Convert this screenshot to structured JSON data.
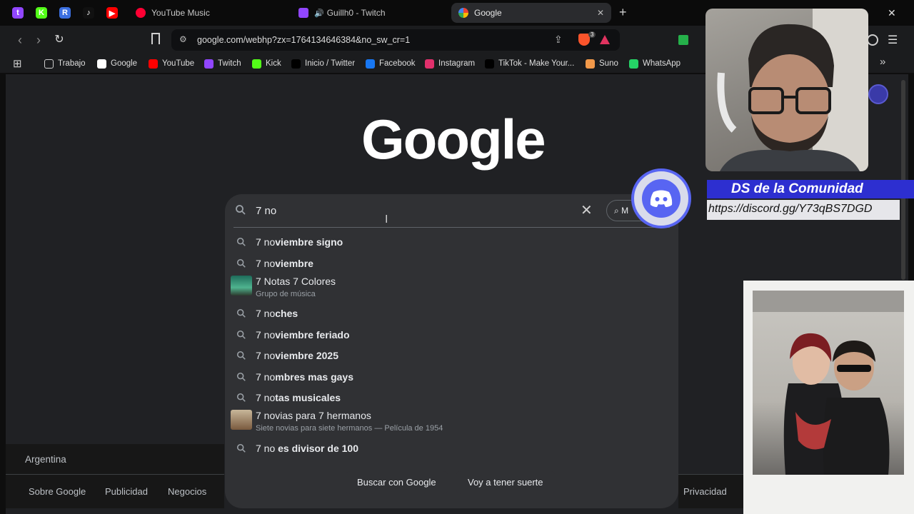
{
  "tabs": {
    "pinned": [
      {
        "name": "twitch-pinned-tab",
        "color": "#9146ff",
        "glyph": "t"
      },
      {
        "name": "kick-pinned-tab",
        "color": "#53fc18",
        "glyph": "K"
      },
      {
        "name": "pinned-tab-r",
        "color": "#3b6fe0",
        "glyph": "R"
      },
      {
        "name": "tiktok-pinned-tab",
        "color": "#111111",
        "glyph": "♪"
      },
      {
        "name": "youtube-pinned-tab",
        "color": "#ff0000",
        "glyph": "▶"
      }
    ],
    "items": [
      {
        "label": "YouTube Music",
        "color": "#ff0033"
      },
      {
        "label": "Guillh0 - Twitch",
        "color": "#9146ff"
      },
      {
        "label": "Google",
        "color": "#ffffff"
      }
    ],
    "new_tab": "+",
    "close_window": "✕"
  },
  "toolbar": {
    "url": "google.com/webhp?zx=1764134646384&no_sw_cr=1",
    "brave_badge": "3"
  },
  "bookmarks": [
    {
      "label": "Trabajo",
      "color": "#3c4043"
    },
    {
      "label": "Google",
      "color": "#ffffff"
    },
    {
      "label": "YouTube",
      "color": "#ff0000"
    },
    {
      "label": "Twitch",
      "color": "#9146ff"
    },
    {
      "label": "Kick",
      "color": "#53fc18"
    },
    {
      "label": "Inicio / Twitter",
      "color": "#000000"
    },
    {
      "label": "Facebook",
      "color": "#1877f2"
    },
    {
      "label": "Instagram",
      "color": "#e1306c"
    },
    {
      "label": "TikTok - Make Your...",
      "color": "#000000"
    },
    {
      "label": "Suno",
      "color": "#f2994a"
    },
    {
      "label": "WhatsApp",
      "color": "#25d366"
    }
  ],
  "google": {
    "logo": "Google",
    "query": "7 no",
    "lens_label": "M",
    "suggestions": [
      {
        "prefix": "7 no",
        "rest": "viembre signo",
        "kind": "query"
      },
      {
        "prefix": "7 no",
        "rest": "viembre",
        "kind": "query"
      },
      {
        "prefix": "",
        "rest": "7 Notas 7 Colores",
        "kind": "entity",
        "sub": "Grupo de música"
      },
      {
        "prefix": "7 no",
        "rest": "ches",
        "kind": "query"
      },
      {
        "prefix": "7 no",
        "rest": "viembre feriado",
        "kind": "query"
      },
      {
        "prefix": "7 no",
        "rest": "viembre 2025",
        "kind": "query"
      },
      {
        "prefix": "7 no",
        "rest": "mbres mas gays",
        "kind": "query"
      },
      {
        "prefix": "7 no",
        "rest": "tas musicales",
        "kind": "query"
      },
      {
        "prefix": "",
        "rest": "7 novias para 7 hermanos",
        "kind": "entity",
        "sub": "Siete novias para siete hermanos — Película de 1954"
      },
      {
        "prefix": "7 no",
        "rest": " es divisor de 100",
        "kind": "query"
      }
    ],
    "buttons": {
      "search": "Buscar con Google",
      "lucky": "Voy a tener suerte"
    },
    "footer": {
      "country": "Argentina",
      "links": [
        "Sobre Google",
        "Publicidad",
        "Negocios"
      ],
      "right": "Privacidad"
    }
  },
  "overlay": {
    "discord_title": "DS de la Comunidad",
    "discord_url": "https://discord.gg/Y73qBS7DGD"
  }
}
